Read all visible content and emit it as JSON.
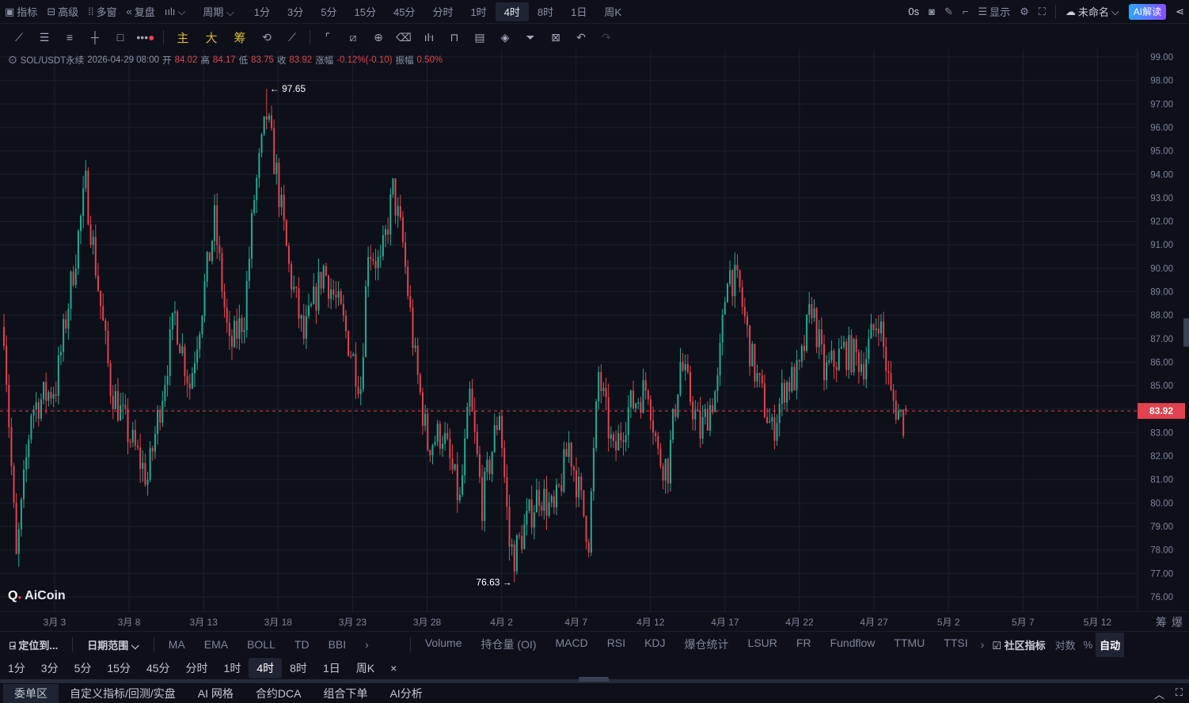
{
  "top": {
    "items": [
      {
        "icon": "chart-icon",
        "label": "指标"
      },
      {
        "icon": "calendar-icon",
        "label": "高级"
      },
      {
        "icon": "windows-icon",
        "label": "多窗"
      },
      {
        "icon": "rewind-icon",
        "label": "复盘"
      },
      {
        "icon": "candle-type-icon",
        "label": "⌵"
      },
      {
        "label": "周期 ⌵"
      }
    ],
    "periods": [
      "1分",
      "3分",
      "5分",
      "15分",
      "45分",
      "分时",
      "1时",
      "4时",
      "8时",
      "1日",
      "周K"
    ],
    "active_period": "4时",
    "countdown": "0s",
    "display": "显示",
    "layout_name": "未命名",
    "ai_button": "AI解读"
  },
  "toolbar": {
    "main": "主",
    "big": "大",
    "chips": "筹"
  },
  "legend": {
    "symbol": "SOL/USDT永续",
    "time": "2026-04-29 08:00",
    "open_label": "开",
    "open": "84.02",
    "high_label": "高",
    "high": "84.17",
    "low_label": "低",
    "low": "83.75",
    "close_label": "收",
    "close": "83.92",
    "change_label": "涨幅",
    "change": "-0.12%(-0.10)",
    "amp_label": "振幅",
    "amp": "0.50%"
  },
  "chart_data": {
    "type": "candlestick",
    "ylim": [
      76,
      99
    ],
    "price_ticks": [
      "99.00",
      "98.00",
      "97.00",
      "96.00",
      "95.00",
      "94.00",
      "93.00",
      "92.00",
      "91.00",
      "90.00",
      "89.00",
      "88.00",
      "87.00",
      "86.00",
      "85.00",
      "84.00",
      "83.00",
      "82.00",
      "81.00",
      "80.00",
      "79.00",
      "78.00",
      "77.00",
      "76.00"
    ],
    "x_labels": [
      "3月 3",
      "3月 8",
      "3月 13",
      "3月 18",
      "3月 23",
      "3月 28",
      "4月 2",
      "4月 7",
      "4月 12",
      "4月 17",
      "4月 22",
      "4月 27",
      "5月 2",
      "5月 7",
      "5月 12"
    ],
    "candle_count": 365,
    "max_label": "97.65",
    "min_label": "76.63",
    "last_price": "83.92",
    "up_color": "#22ab94",
    "down_color": "#e2424f",
    "approx_close_path": [
      [
        0,
        87.5
      ],
      [
        5,
        77.5
      ],
      [
        11,
        84
      ],
      [
        21,
        85
      ],
      [
        33,
        93.5
      ],
      [
        43,
        85
      ],
      [
        50,
        83
      ],
      [
        58,
        81
      ],
      [
        69,
        88
      ],
      [
        75,
        85
      ],
      [
        85,
        92
      ],
      [
        91,
        86.5
      ],
      [
        97,
        88
      ],
      [
        101,
        93
      ],
      [
        106,
        96.5
      ],
      [
        110,
        94
      ],
      [
        115,
        90
      ],
      [
        121,
        87
      ],
      [
        129,
        90
      ],
      [
        136,
        88
      ],
      [
        144,
        85
      ],
      [
        147,
        91
      ],
      [
        152,
        90
      ],
      [
        157,
        93.3
      ],
      [
        161,
        91
      ],
      [
        166,
        86
      ],
      [
        171,
        82.5
      ],
      [
        177,
        83
      ],
      [
        184,
        80
      ],
      [
        188,
        84.5
      ],
      [
        193,
        80
      ],
      [
        200,
        84
      ],
      [
        204,
        78.2
      ],
      [
        206,
        77.8
      ],
      [
        216,
        80.5
      ],
      [
        222,
        79.5
      ],
      [
        228,
        82.5
      ],
      [
        236,
        78.5
      ],
      [
        240,
        85.5
      ],
      [
        246,
        82
      ],
      [
        252,
        84
      ],
      [
        260,
        85
      ],
      [
        264,
        82
      ],
      [
        268,
        81.5
      ],
      [
        273,
        86
      ],
      [
        281,
        83
      ],
      [
        288,
        85
      ],
      [
        292,
        90
      ],
      [
        297,
        89
      ],
      [
        302,
        86
      ],
      [
        310,
        83
      ],
      [
        315,
        85
      ],
      [
        321,
        85.5
      ],
      [
        326,
        88.5
      ],
      [
        331,
        85.5
      ],
      [
        339,
        86.5
      ],
      [
        347,
        86
      ],
      [
        353,
        88
      ],
      [
        358,
        84.5
      ],
      [
        363,
        83.5
      ],
      [
        364,
        83.92
      ]
    ]
  },
  "axis": {
    "chips": "筹",
    "liq": "爆"
  },
  "indicators": {
    "locate": "定位到...",
    "range": "日期范围 ⌵",
    "main": [
      "MA",
      "EMA",
      "BOLL",
      "TD",
      "BBI"
    ],
    "sub": [
      "Volume",
      "持仓量 (OI)",
      "MACD",
      "RSI",
      "KDJ",
      "爆仓统计",
      "LSUR",
      "FR",
      "Fundflow",
      "TTMU",
      "TTSI"
    ],
    "community": "社区指标",
    "log": "对数",
    "pct": "%",
    "auto": "自动"
  },
  "period_bar": [
    "1分",
    "3分",
    "5分",
    "15分",
    "45分",
    "分时",
    "1时",
    "4时",
    "8时",
    "1日",
    "周K"
  ],
  "bottom": [
    "委单区",
    "自定义指标/回测/实盘",
    "AI 网格",
    "合约DCA",
    "组合下单",
    "AI分析"
  ],
  "logo": "AiCoin"
}
